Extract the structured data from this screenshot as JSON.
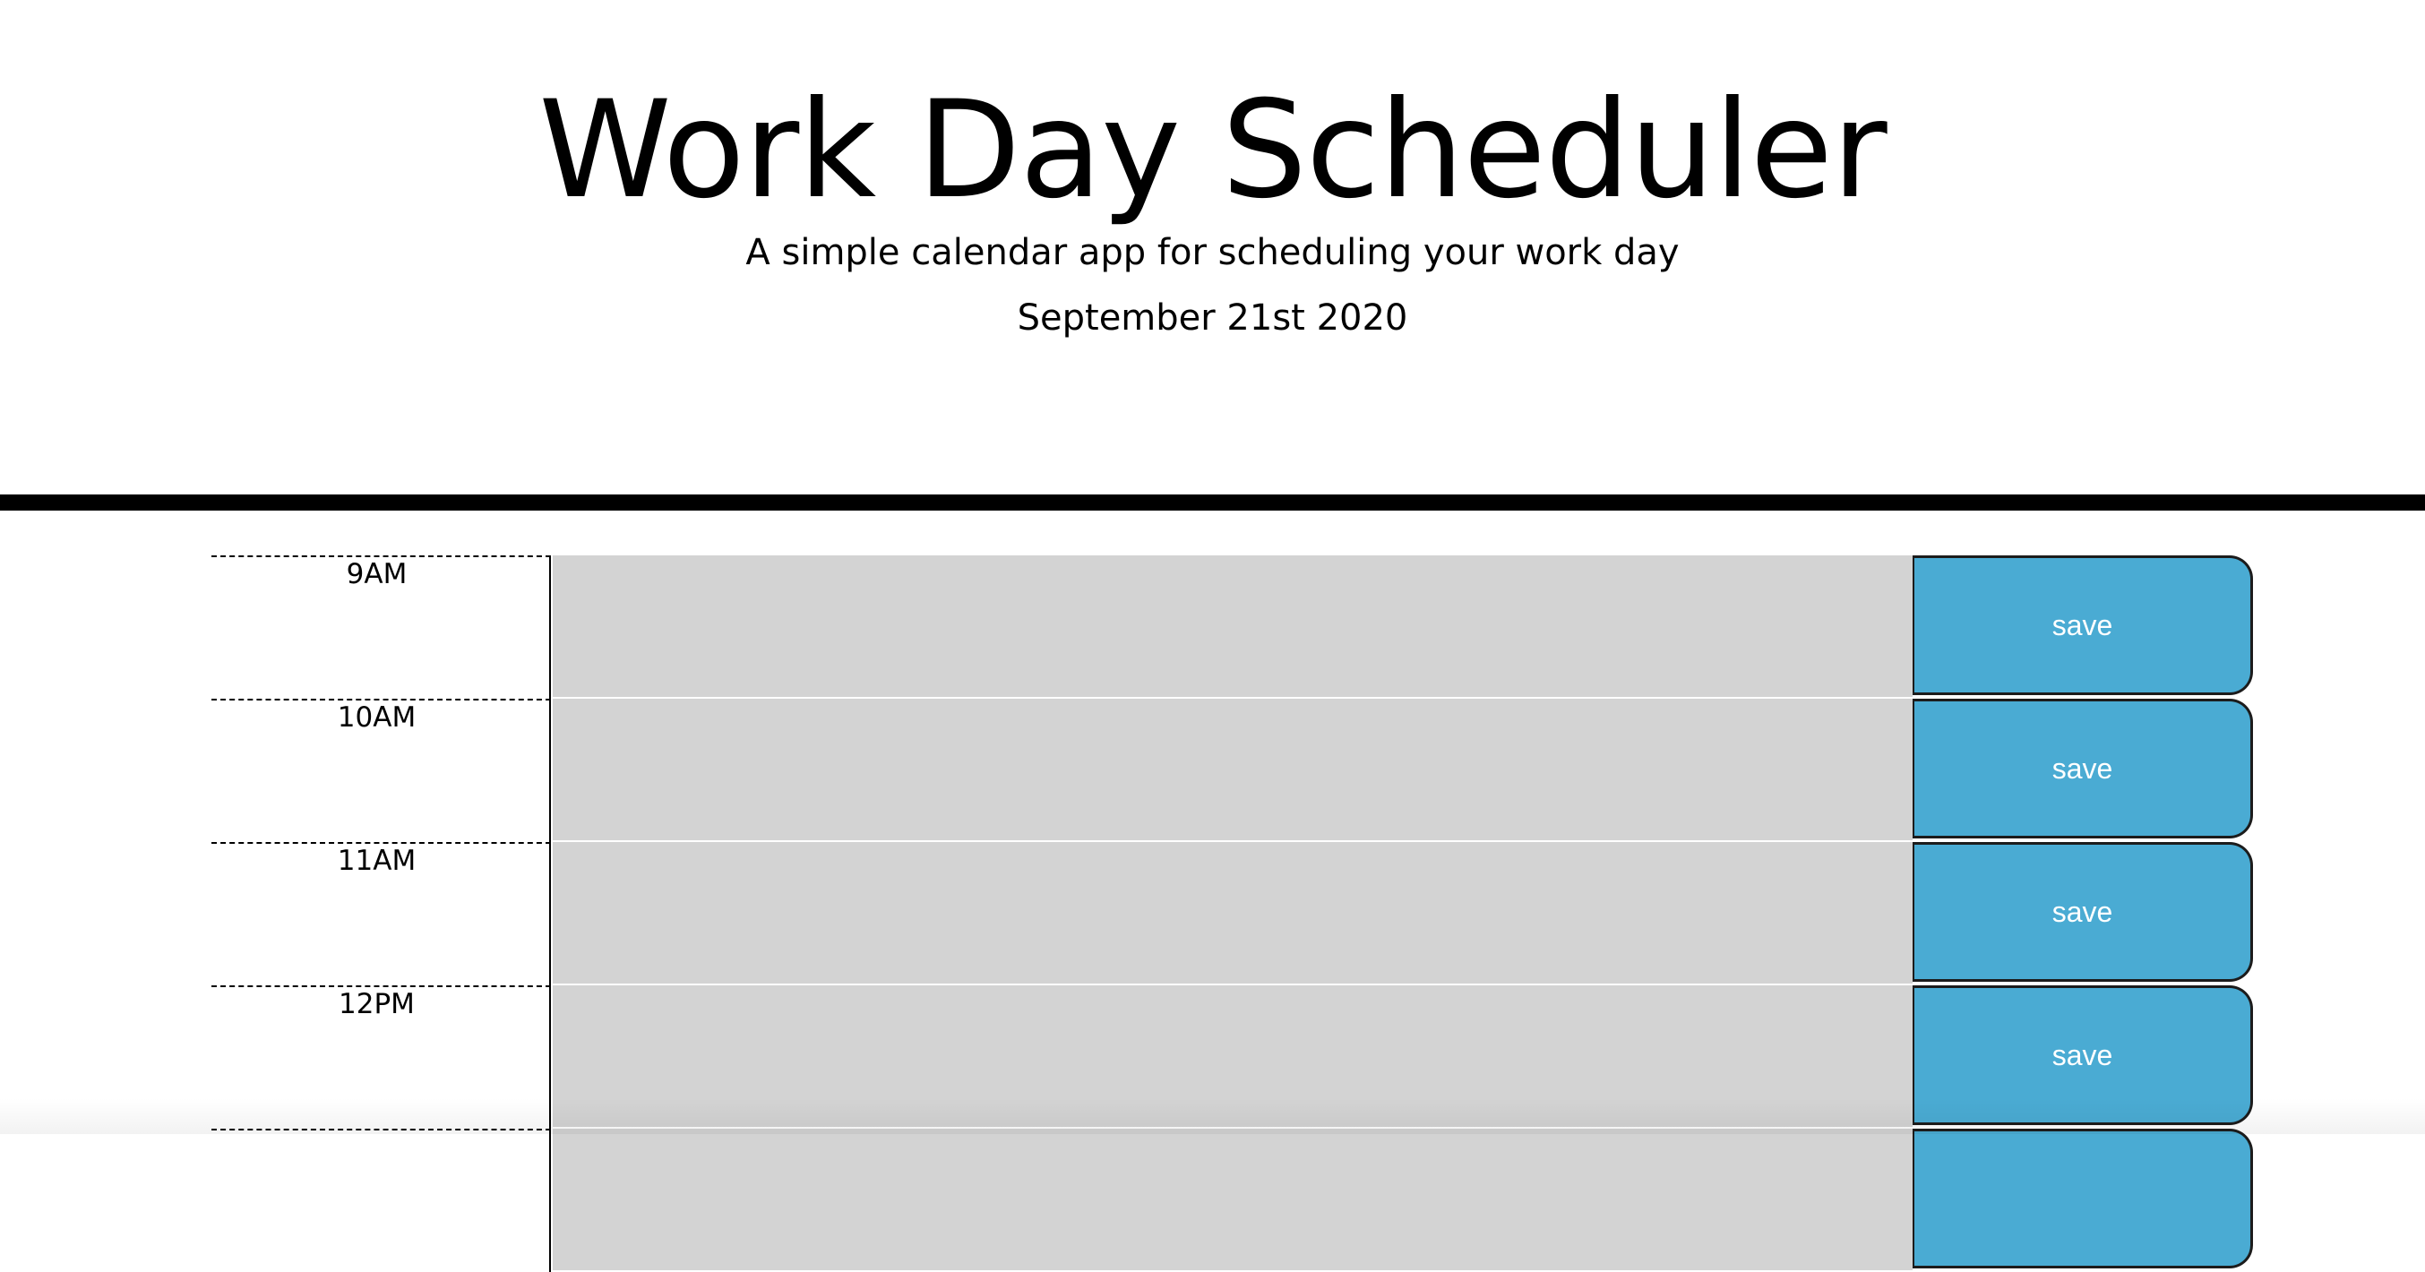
{
  "header": {
    "title": "Work Day Scheduler",
    "subtitle": "A simple calendar app for scheduling your work day",
    "current_date": "September 21st 2020"
  },
  "time_blocks": [
    {
      "hour": "9AM",
      "description": "",
      "save_label": "save"
    },
    {
      "hour": "10AM",
      "description": "",
      "save_label": "save"
    },
    {
      "hour": "11AM",
      "description": "",
      "save_label": "save"
    },
    {
      "hour": "12PM",
      "description": "",
      "save_label": "save"
    },
    {
      "hour": "",
      "description": "",
      "save_label": ""
    }
  ],
  "colors": {
    "save_button": "#4aabd3",
    "past_block": "#d3d3d3",
    "header_border": "#000000"
  }
}
